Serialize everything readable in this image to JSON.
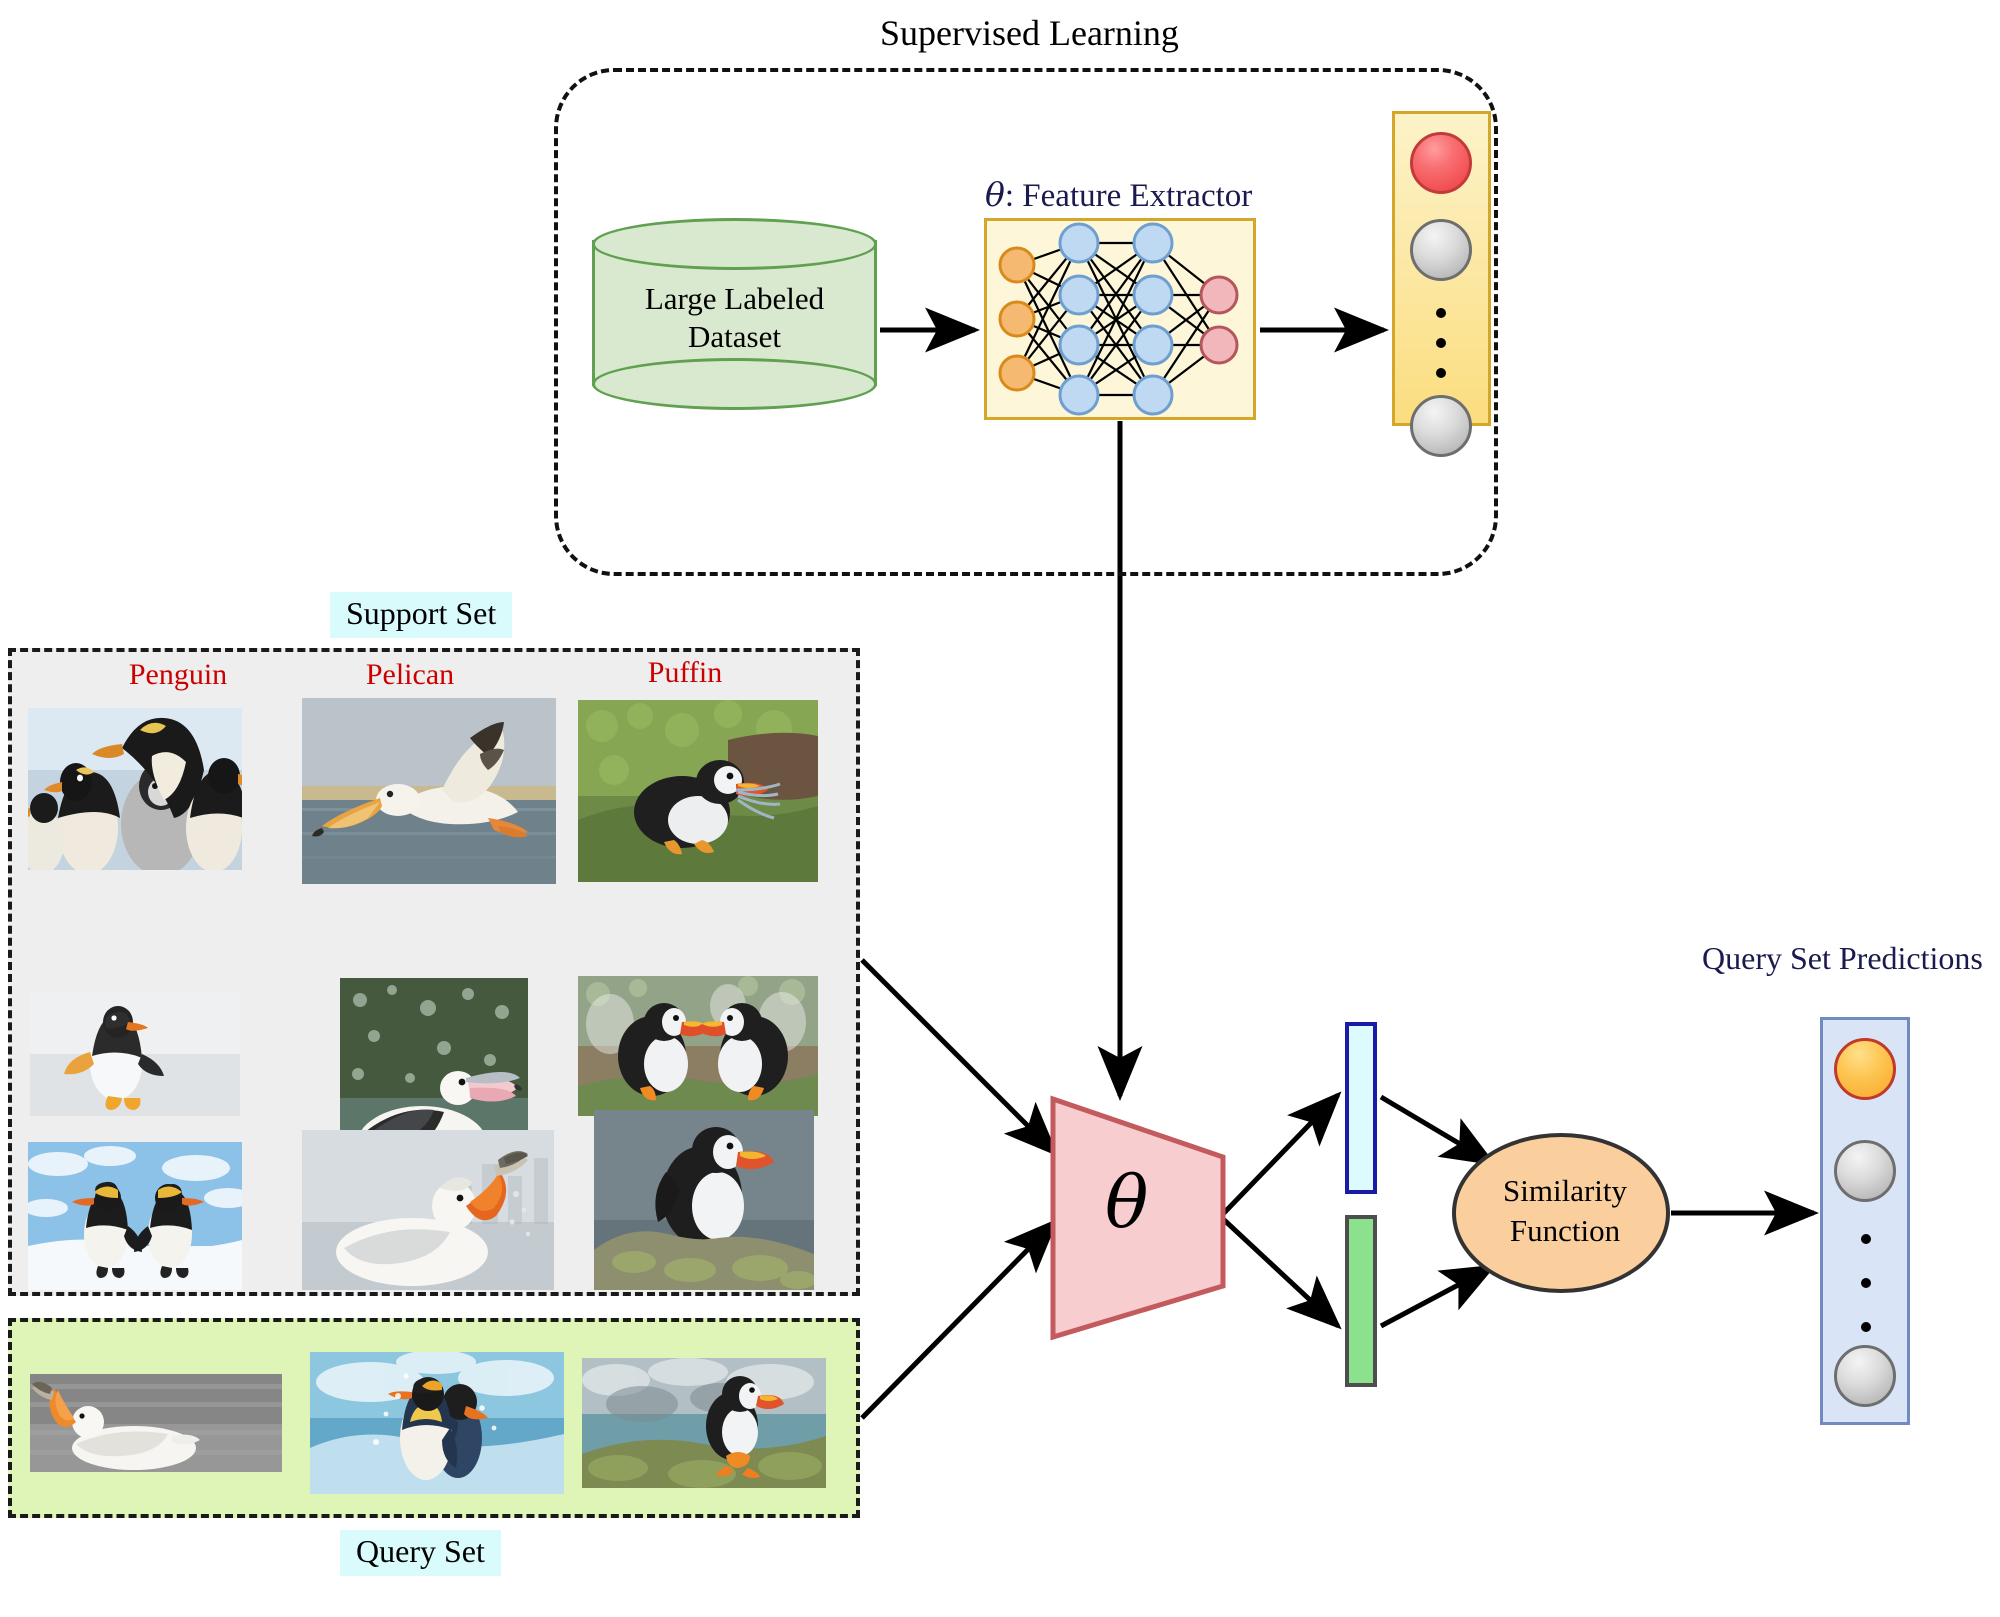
{
  "diagram": {
    "title_supervised": "Supervised Learning",
    "feature_extractor_symbol": "θ",
    "feature_extractor_label": ": Feature Extractor",
    "dataset_line1": "Large Labeled",
    "dataset_line2": "Dataset",
    "support_set_tag": "Support Set",
    "query_set_tag": "Query Set",
    "query_set_predictions_label": "Query Set Predictions",
    "theta_symbol": "θ",
    "similarity_line1": "Similarity",
    "similarity_line2": "Function"
  },
  "support_set": {
    "class_labels": [
      "Penguin",
      "Pelican",
      "Puffin"
    ],
    "images": [
      {
        "label": "penguin-colony-photo",
        "column": "Penguin"
      },
      {
        "label": "pelican-flying-photo",
        "column": "Pelican"
      },
      {
        "label": "puffin-with-fish-photo",
        "column": "Puffin"
      },
      {
        "label": "gentoo-penguin-photo",
        "column": "Penguin"
      },
      {
        "label": "pelican-open-bill-photo",
        "column": "Pelican"
      },
      {
        "label": "two-puffins-photo",
        "column": "Puffin"
      },
      {
        "label": "two-penguins-snow-photo",
        "column": "Penguin"
      },
      {
        "label": "pelican-catching-fish-photo",
        "column": "Pelican"
      },
      {
        "label": "puffin-on-rock-photo",
        "column": "Puffin"
      }
    ]
  },
  "query_set": {
    "images": [
      {
        "label": "pelican-swimming-photo"
      },
      {
        "label": "king-penguin-wave-photo"
      },
      {
        "label": "puffin-cliff-photo"
      }
    ]
  },
  "neural_network": {
    "layers": [
      3,
      4,
      4,
      2
    ],
    "input_node_color": "#f5b971",
    "input_node_border": "#d98a1a",
    "hidden_node_color": "#bfd9f2",
    "hidden_node_border": "#6f9fd0",
    "output_node_color": "#f2b7bb",
    "output_node_border": "#b5565c",
    "panel_fill": "#fdf6d8",
    "panel_border": "#d4a62a"
  },
  "classifier_column": {
    "fill_top": "#fdf3c9",
    "fill_bottom": "#fbdd7f",
    "border": "#d4a62a",
    "balls": [
      "red",
      "grey",
      "grey"
    ],
    "ellipsis_dots": 3
  },
  "predictions_column": {
    "fill": "#d9e5f7",
    "border": "#6f8bbf",
    "balls": [
      "orange",
      "grey",
      "grey"
    ],
    "ellipsis_dots": 3
  },
  "colors": {
    "support_box_fill": "#eeeeee",
    "query_box_fill": "#dff5b8",
    "dataset_fill": "#d8e9cf",
    "dataset_border": "#60a050",
    "theta_fill": "#f7cdd0",
    "theta_border": "#c35a5e",
    "blue_bar_fill": "#ddfbff",
    "blue_bar_border": "#1a1aa8",
    "green_bar_fill": "#8ce28c",
    "green_bar_border": "#4e4e4e",
    "similarity_fill": "#fbcf9d",
    "similarity_border": "#333333",
    "class_label_red": "#cc0000",
    "heading_navy": "#1b1a4e",
    "tag_cyan": "#d9fbfc"
  }
}
